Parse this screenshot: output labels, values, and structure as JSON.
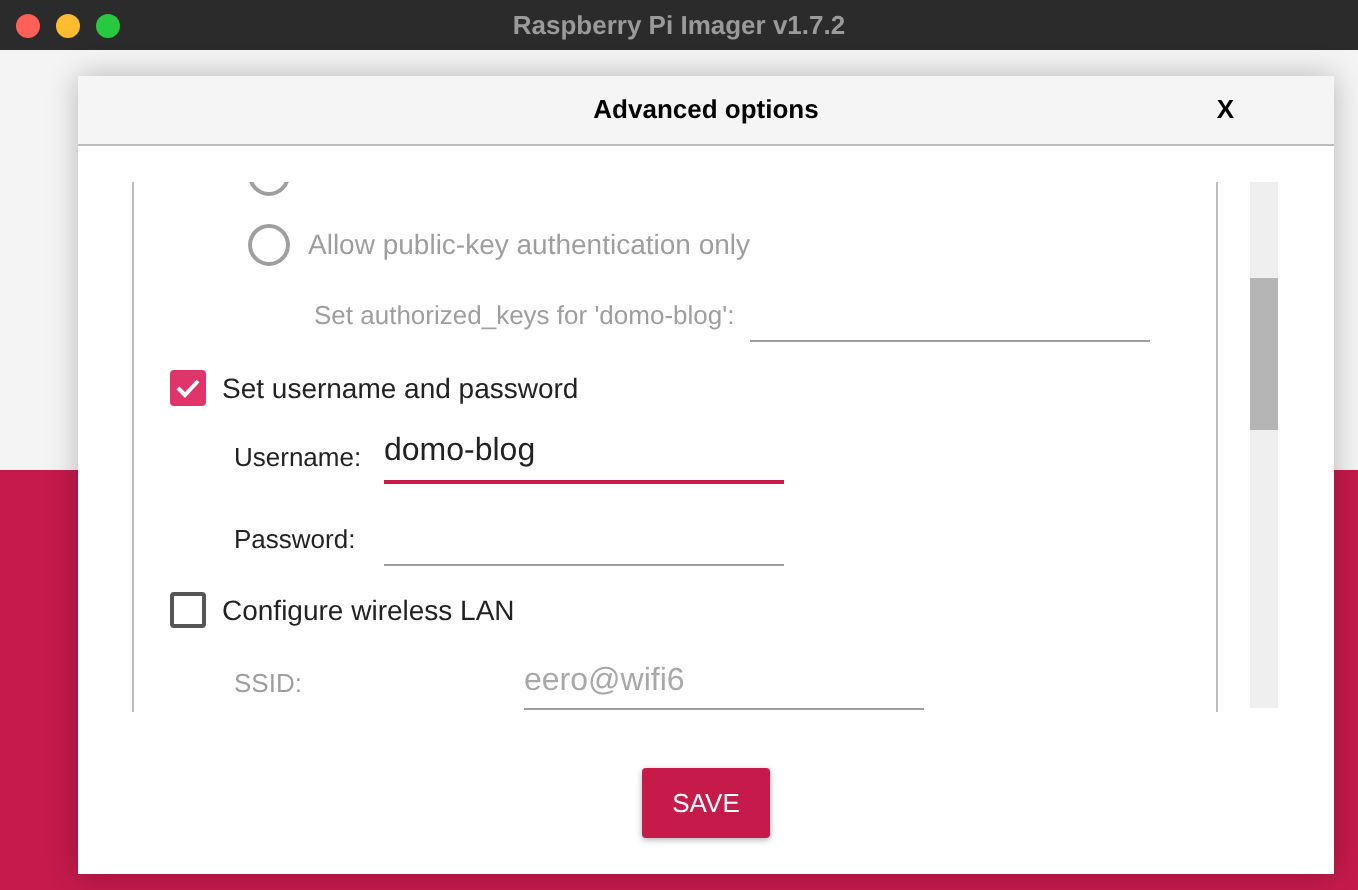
{
  "window": {
    "title": "Raspberry Pi Imager v1.7.2"
  },
  "dialog": {
    "title": "Advanced options",
    "close": "X"
  },
  "auth_radios": [
    {
      "selected": false,
      "disabled": true
    },
    {
      "label": "Allow public-key authentication only",
      "selected": false,
      "disabled": true
    }
  ],
  "authorized_keys": {
    "label": "Set authorized_keys for 'domo-blog':",
    "disabled": true
  },
  "credentials": {
    "label": "Set username and password",
    "checked": true,
    "fields": [
      {
        "label": "Username:",
        "value": "domo-blog",
        "focused": true
      },
      {
        "label": "Password:",
        "focused": false
      }
    ]
  },
  "wireless": {
    "label": "Configure wireless LAN",
    "checked": false,
    "fields": [
      {
        "label": "SSID:",
        "placeholder": "eero@wifi6",
        "disabled": true
      }
    ]
  },
  "save_button": "SAVE"
}
